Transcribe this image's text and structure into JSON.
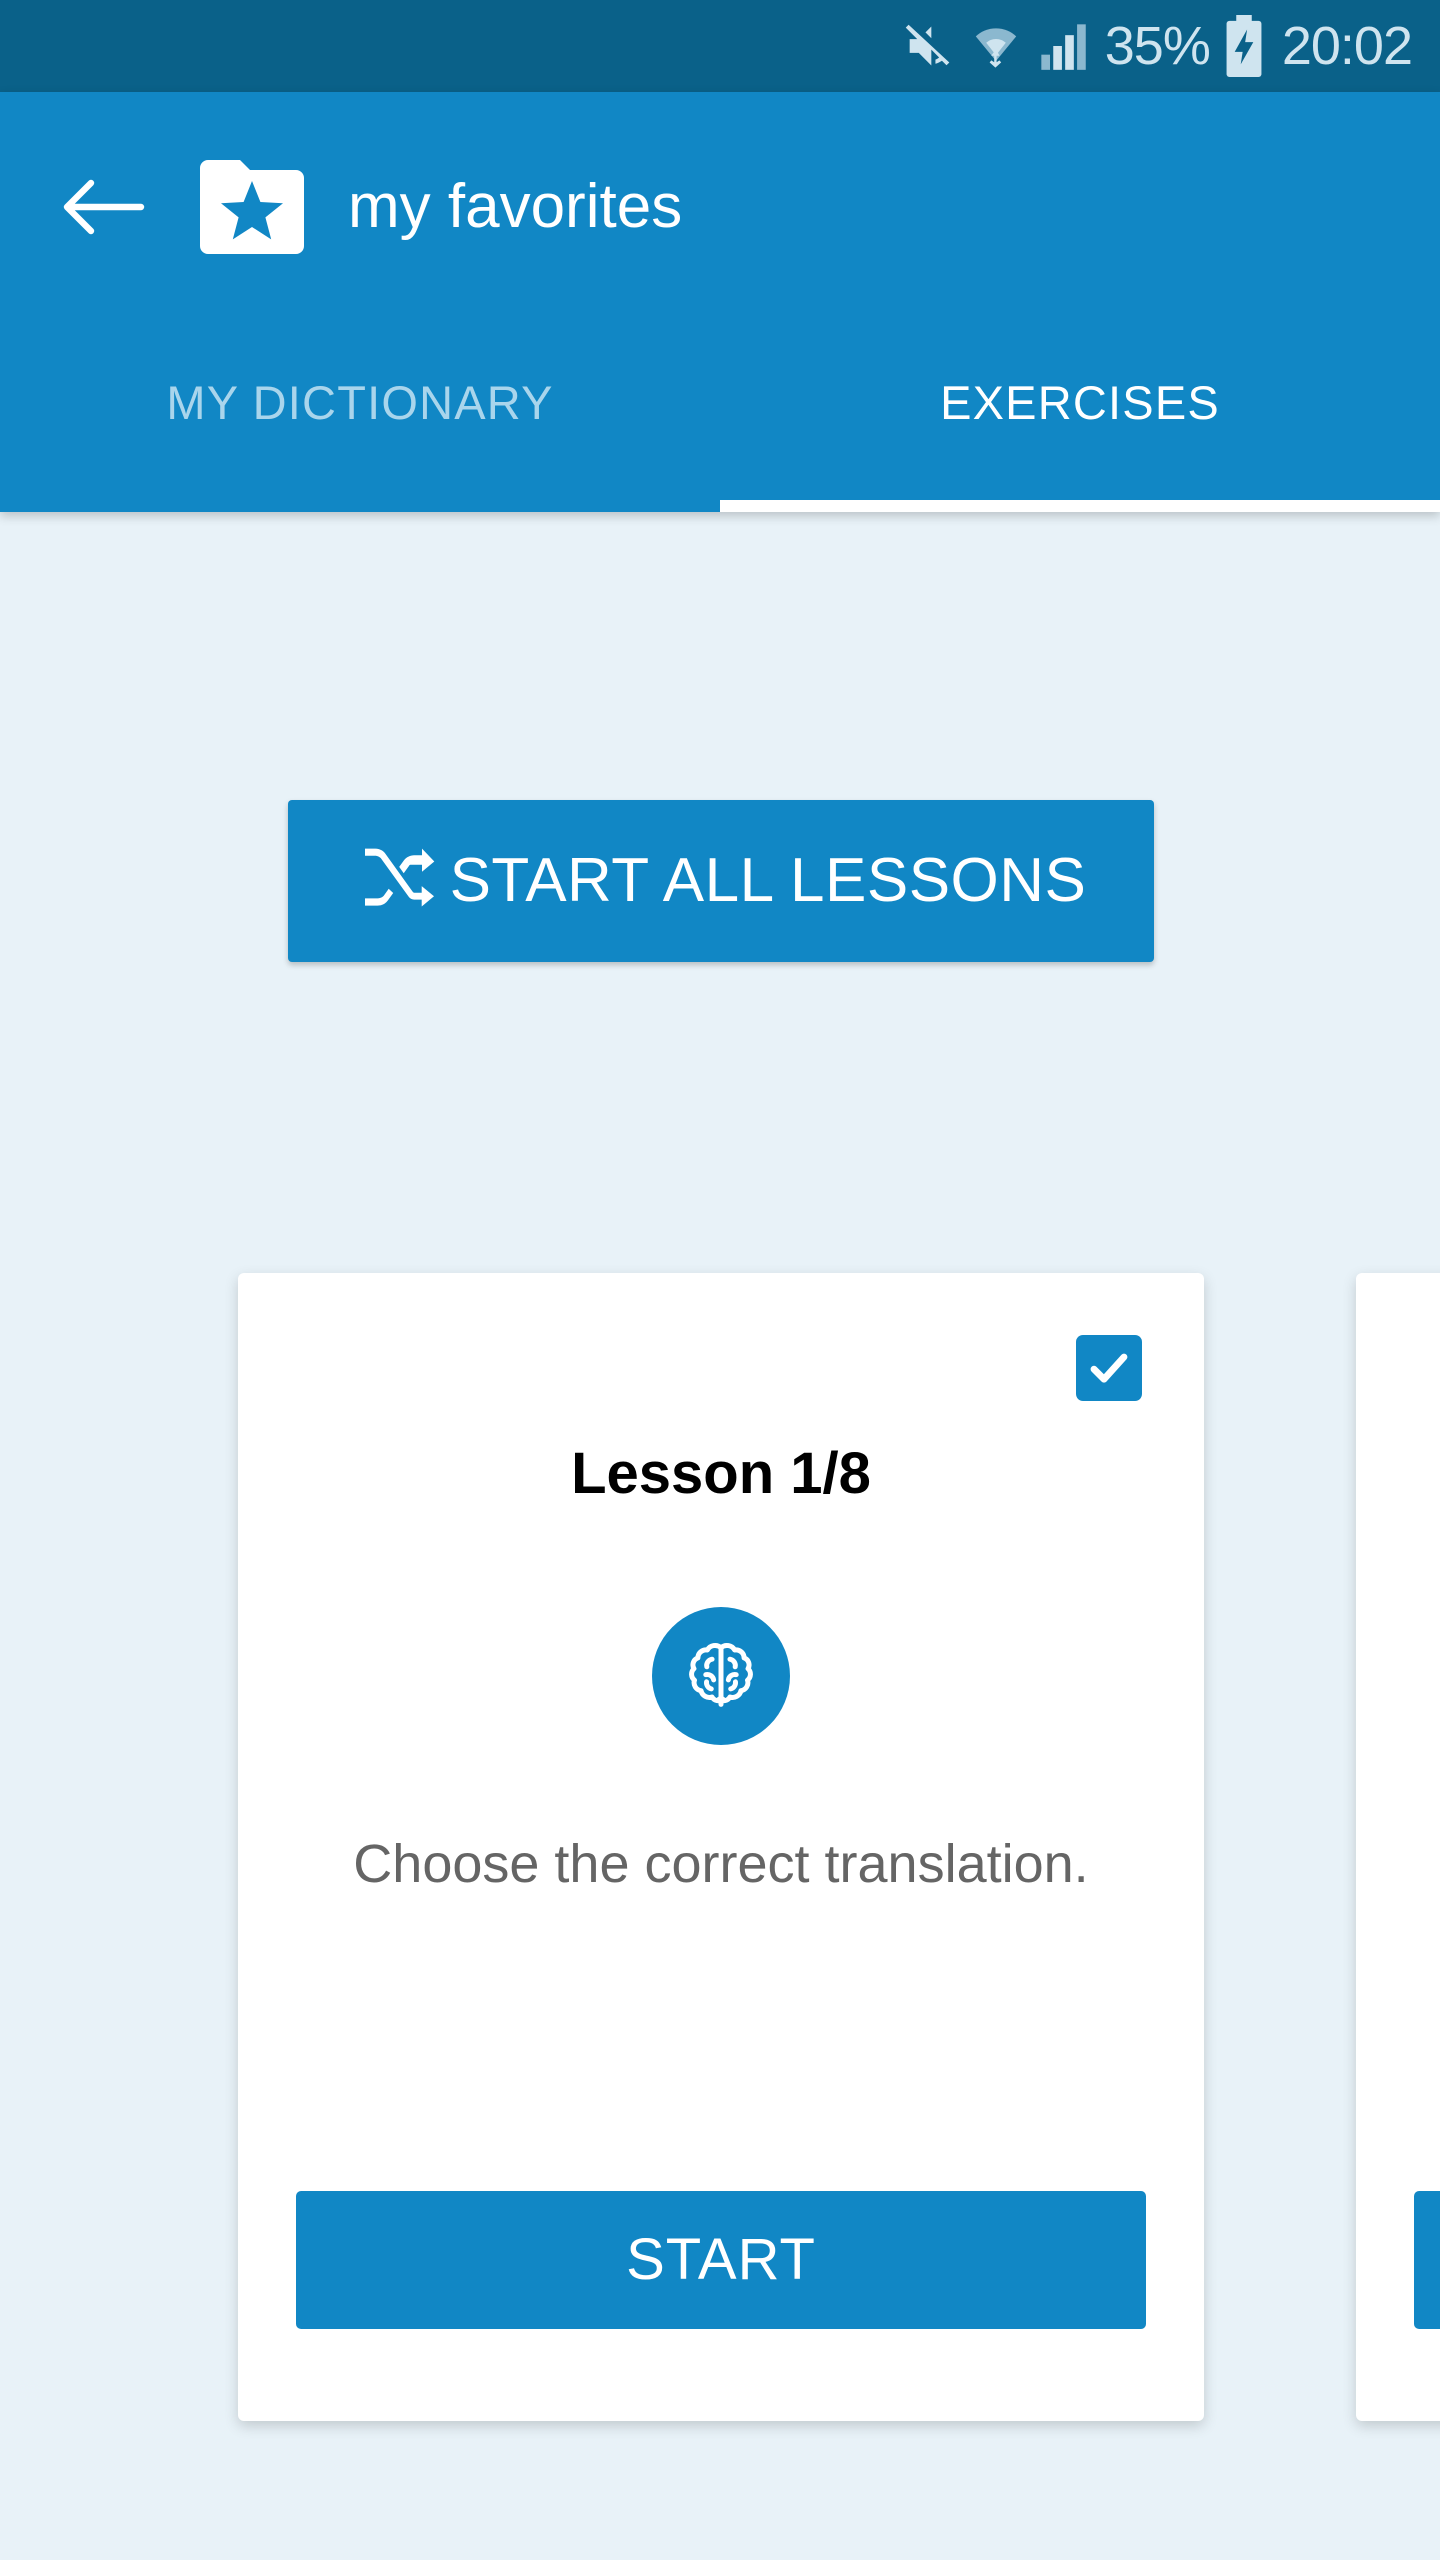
{
  "statusbar": {
    "icons": [
      "mute-icon",
      "wifi-icon",
      "signal-icon",
      "battery-charging-icon"
    ],
    "battery_percent": "35%",
    "time": "20:02",
    "background_color": "#0a6189",
    "text_color": "#cfe4ef"
  },
  "appbar": {
    "back_icon": "back-arrow-icon",
    "folder_icon": "folder-star-icon",
    "title": "my favorites",
    "background_color": "#1187c5"
  },
  "tabs": [
    {
      "label": "MY DICTIONARY",
      "active": false
    },
    {
      "label": "EXERCISES",
      "active": true
    }
  ],
  "main": {
    "start_all": {
      "label": "START ALL LESSONS",
      "icon": "shuffle-icon",
      "color": "#1187c5"
    },
    "cards": [
      {
        "title": "Lesson 1/8",
        "icon": "brain-icon",
        "description": "Choose the correct translation.",
        "start_label": "START",
        "checked": true
      },
      {
        "title": "",
        "icon": "brain-icon",
        "description": "",
        "start_label": "",
        "checked": false
      }
    ]
  },
  "theme": {
    "accent": "#1187c5",
    "page_background": "#e8f2f8",
    "card_background": "#ffffff",
    "muted_text": "#656565"
  }
}
